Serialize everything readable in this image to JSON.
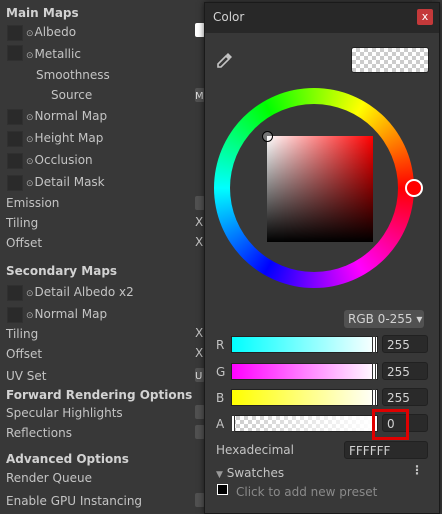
{
  "inspector": {
    "main_maps": "Main Maps",
    "albedo": "Albedo",
    "metallic": "Metallic",
    "smoothness": "Smoothness",
    "source": "Source",
    "normal_map": "Normal Map",
    "height_map": "Height Map",
    "occlusion": "Occlusion",
    "detail_mask": "Detail Mask",
    "emission": "Emission",
    "tiling": "Tiling",
    "offset": "Offset",
    "secondary_maps": "Secondary Maps",
    "detail_albedo": "Detail Albedo x2",
    "normal_map2": "Normal Map",
    "tiling2": "Tiling",
    "offset2": "Offset",
    "uv_set": "UV Set",
    "forward_rendering": "Forward Rendering Options",
    "specular_highlights": "Specular Highlights",
    "reflections": "Reflections",
    "advanced_options": "Advanced Options",
    "render_queue": "Render Queue",
    "gpu_instancing": "Enable GPU Instancing",
    "x_label": "X",
    "m_label": "M",
    "u_label": "U"
  },
  "color_window": {
    "title": "Color",
    "close": "x",
    "mode": "RGB 0-255",
    "mode_arrow": "▾",
    "channels": [
      {
        "label": "R",
        "value": "255"
      },
      {
        "label": "G",
        "value": "255"
      },
      {
        "label": "B",
        "value": "255"
      },
      {
        "label": "A",
        "value": "0"
      }
    ],
    "hex_label": "Hexadecimal",
    "hex_value": "FFFFFF",
    "swatches_label": "Swatches",
    "swatches_hint": "Click to add new preset",
    "kebab": "⋮"
  },
  "icons": [
    "eyedropper-icon",
    "close-icon",
    "foldout-triangle-icon",
    "preset-swatch-icon",
    "kebab-menu-icon"
  ],
  "colors": {
    "background": "#383838",
    "title_bar": "#282828",
    "close": "#c4393a",
    "highlight": "#e00000"
  }
}
